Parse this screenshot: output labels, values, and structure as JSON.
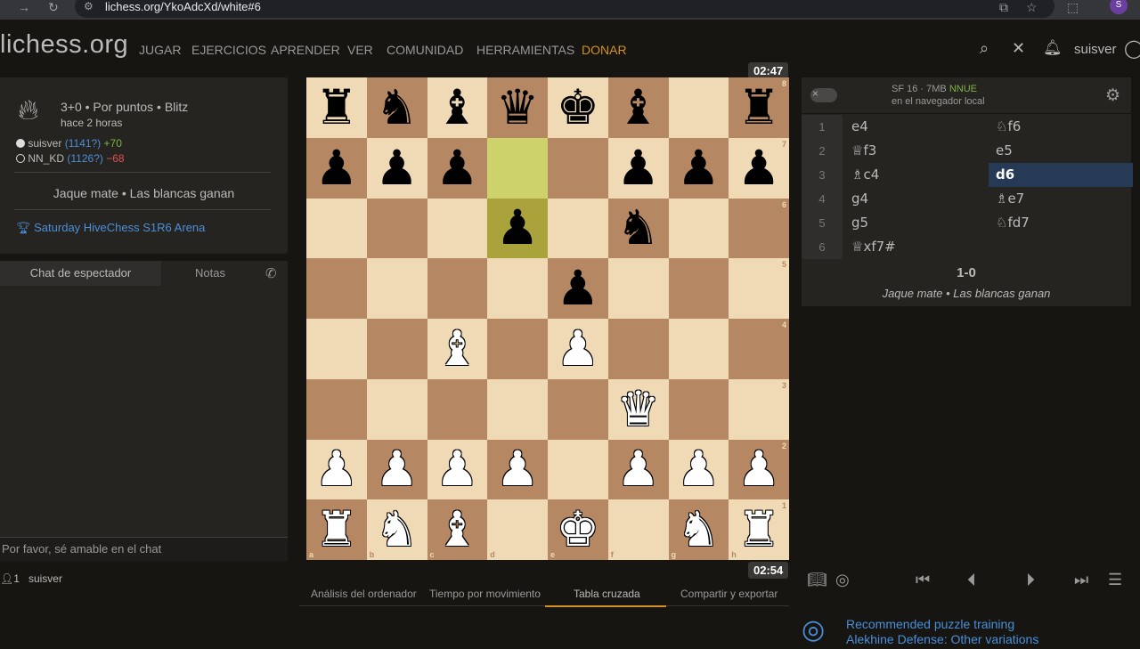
{
  "browser": {
    "url": "lichess.org/YkoAdcXd/white#6",
    "profile_initial": "S"
  },
  "site": {
    "logo": "lichess.org",
    "nav": [
      "JUGAR",
      "EJERCICIOS",
      "APRENDER",
      "VER",
      "COMUNIDAD",
      "HERRAMIENTAS",
      "DONAR"
    ],
    "username": "suisver",
    "donate_color": "#d59120"
  },
  "game_info": {
    "mode": "3+0 • Por puntos • Blitz",
    "time_ago": "hace 2 horas",
    "players": [
      {
        "name": "suisver",
        "rating": "(1141?)",
        "diff": "+70",
        "side": "white"
      },
      {
        "name": "NN_KD",
        "rating": "(1126?)",
        "diff": "−68",
        "side": "black"
      }
    ],
    "result": "Jaque mate • Las blancas ganan",
    "tournament": "Saturday HiveChess S1R6 Arena"
  },
  "chat": {
    "tab_chat": "Chat de espectador",
    "tab_notes": "Notas",
    "placeholder": "Por favor, sé amable en el chat",
    "spectators_count": "1",
    "spectator": "suisver"
  },
  "clocks": {
    "top": "02:47",
    "bottom": "02:54"
  },
  "board": {
    "orientation": "white",
    "colors": {
      "light": "#f0d9b5",
      "dark": "#b58863"
    },
    "files": [
      "a",
      "b",
      "c",
      "d",
      "e",
      "f",
      "g",
      "h"
    ],
    "ranks": [
      "8",
      "7",
      "6",
      "5",
      "4",
      "3",
      "2",
      "1"
    ],
    "highlight_squares": [
      "d7",
      "d6"
    ],
    "pieces": [
      {
        "sq": "a8",
        "p": "r"
      },
      {
        "sq": "b8",
        "p": "n"
      },
      {
        "sq": "c8",
        "p": "b"
      },
      {
        "sq": "d8",
        "p": "q"
      },
      {
        "sq": "e8",
        "p": "k"
      },
      {
        "sq": "f8",
        "p": "b"
      },
      {
        "sq": "h8",
        "p": "r"
      },
      {
        "sq": "a7",
        "p": "p"
      },
      {
        "sq": "b7",
        "p": "p"
      },
      {
        "sq": "c7",
        "p": "p"
      },
      {
        "sq": "f7",
        "p": "p"
      },
      {
        "sq": "g7",
        "p": "p"
      },
      {
        "sq": "h7",
        "p": "p"
      },
      {
        "sq": "d6",
        "p": "p"
      },
      {
        "sq": "f6",
        "p": "n"
      },
      {
        "sq": "e5",
        "p": "p"
      },
      {
        "sq": "c4",
        "p": "B"
      },
      {
        "sq": "e4",
        "p": "P"
      },
      {
        "sq": "f3",
        "p": "Q"
      },
      {
        "sq": "a2",
        "p": "P"
      },
      {
        "sq": "b2",
        "p": "P"
      },
      {
        "sq": "c2",
        "p": "P"
      },
      {
        "sq": "d2",
        "p": "P"
      },
      {
        "sq": "f2",
        "p": "P"
      },
      {
        "sq": "g2",
        "p": "P"
      },
      {
        "sq": "h2",
        "p": "P"
      },
      {
        "sq": "a1",
        "p": "R"
      },
      {
        "sq": "b1",
        "p": "N"
      },
      {
        "sq": "c1",
        "p": "B"
      },
      {
        "sq": "e1",
        "p": "K"
      },
      {
        "sq": "g1",
        "p": "N"
      },
      {
        "sq": "h1",
        "p": "R"
      }
    ]
  },
  "bottom_tabs": [
    "Análisis del ordenador",
    "Tiempo por movimiento",
    "Tabla cruzada",
    "Compartir y exportar"
  ],
  "bottom_tabs_active": "Tabla cruzada",
  "engine": {
    "name": "SF 16 · 7MB",
    "nnue": "NNUE",
    "location": "en el navegador local"
  },
  "moves": [
    {
      "n": "1",
      "w": "e4",
      "b": "♘f6"
    },
    {
      "n": "2",
      "w": "♕f3",
      "b": "e5"
    },
    {
      "n": "3",
      "w": "♗c4",
      "b": "d6"
    },
    {
      "n": "4",
      "w": "g4",
      "b": "♗e7"
    },
    {
      "n": "5",
      "w": "g5",
      "b": "♘fd7"
    },
    {
      "n": "6",
      "w": "♕xf7#",
      "b": ""
    }
  ],
  "active_move": "d6",
  "final": {
    "score": "1-0",
    "text": "Jaque mate • Las blancas ganan"
  },
  "puzzle": {
    "line1": "Recommended puzzle training",
    "line2": "Alekhine Defense: Other variations"
  }
}
